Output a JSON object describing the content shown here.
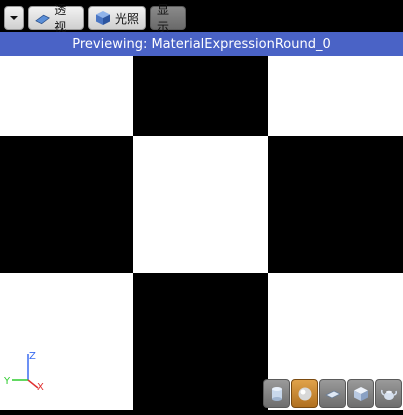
{
  "toolbar": {
    "perspective_label": "透视",
    "lighting_label": "光照",
    "show_label": "显示"
  },
  "preview_title": "Previewing: MaterialExpressionRound_0",
  "axis": {
    "z_label": "Z",
    "y_label": "Y",
    "x_label": "X"
  },
  "shape_buttons": {
    "items": [
      "cylinder",
      "sphere",
      "plane",
      "cube",
      "custom-mesh"
    ],
    "active": "sphere"
  }
}
